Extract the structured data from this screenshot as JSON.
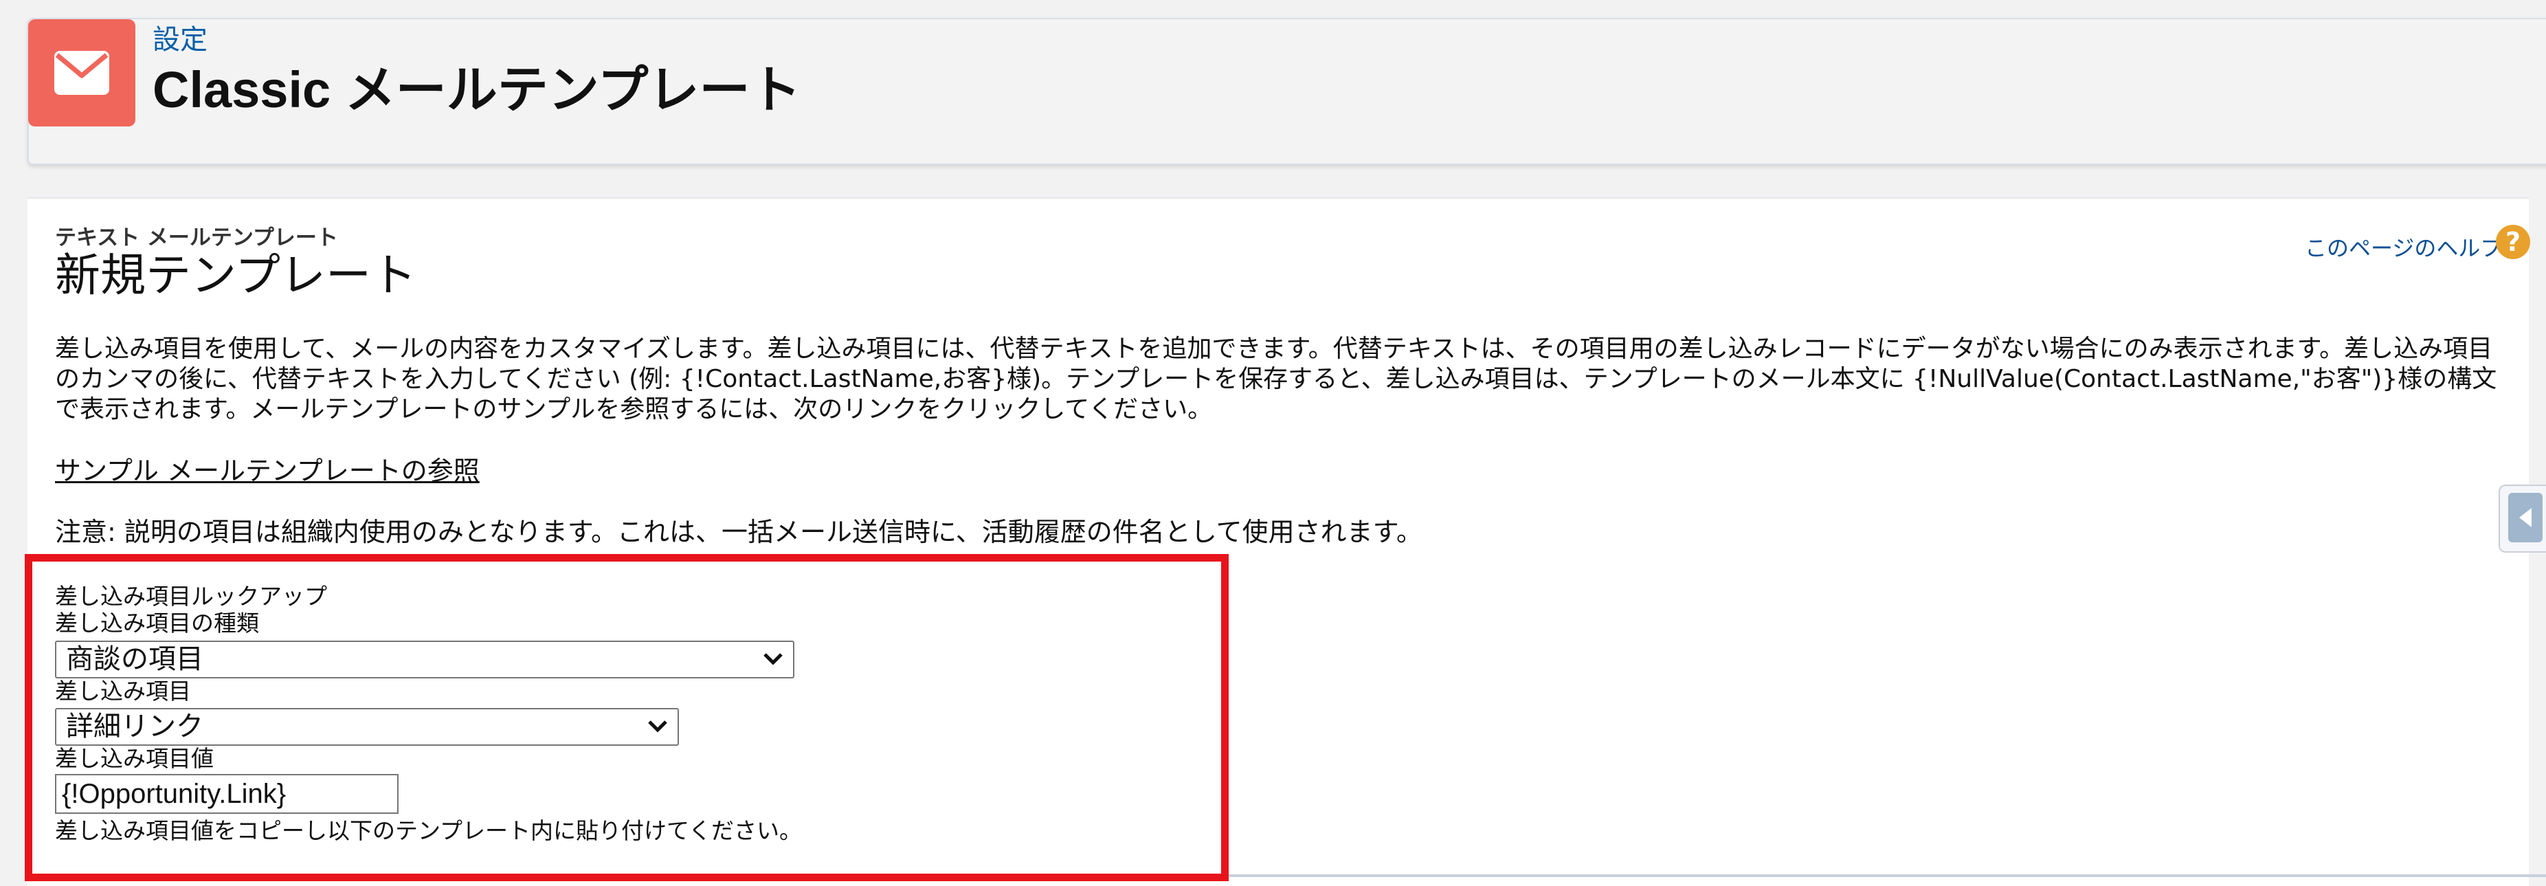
{
  "header": {
    "breadcrumb": "設定",
    "title": "Classic メールテンプレート",
    "icon": "envelope-icon",
    "icon_bg": "#f0665b"
  },
  "panel": {
    "subtitle_small": "テキスト メールテンプレート",
    "subtitle_large": "新規テンプレート",
    "help_link": "このページのヘルプ",
    "help_icon_text": "?",
    "description": "差し込み項目を使用して、メールの内容をカスタマイズします。差し込み項目には、代替テキストを追加できます。代替テキストは、その項目用の差し込みレコードにデータがない場合にのみ表示されます。差し込み項目のカンマの後に、代替テキストを入力してください (例: {!Contact.LastName,お客}様)。テンプレートを保存すると、差し込み項目は、テンプレートのメール本文に {!NullValue(Contact.LastName,\"お客\")}様の構文で表示されます。メールテンプレートのサンプルを参照するには、次のリンクをクリックしてください。",
    "sample_link": "サンプル メールテンプレートの参照",
    "note": "注意: 説明の項目は組織内使用のみとなります。これは、一括メール送信時に、活動履歴の件名として使用されます。"
  },
  "lookup": {
    "section_label": "差し込み項目ルックアップ",
    "type_label": "差し込み項目の種類",
    "type_value": "商談の項目",
    "field_label": "差し込み項目",
    "field_value": "詳細リンク",
    "value_label": "差し込み項目値",
    "value_value": "{!Opportunity.Link}",
    "instruction": "差し込み項目値をコピーし以下のテンプレート内に貼り付けてください。",
    "highlight_color": "#e8141c"
  }
}
